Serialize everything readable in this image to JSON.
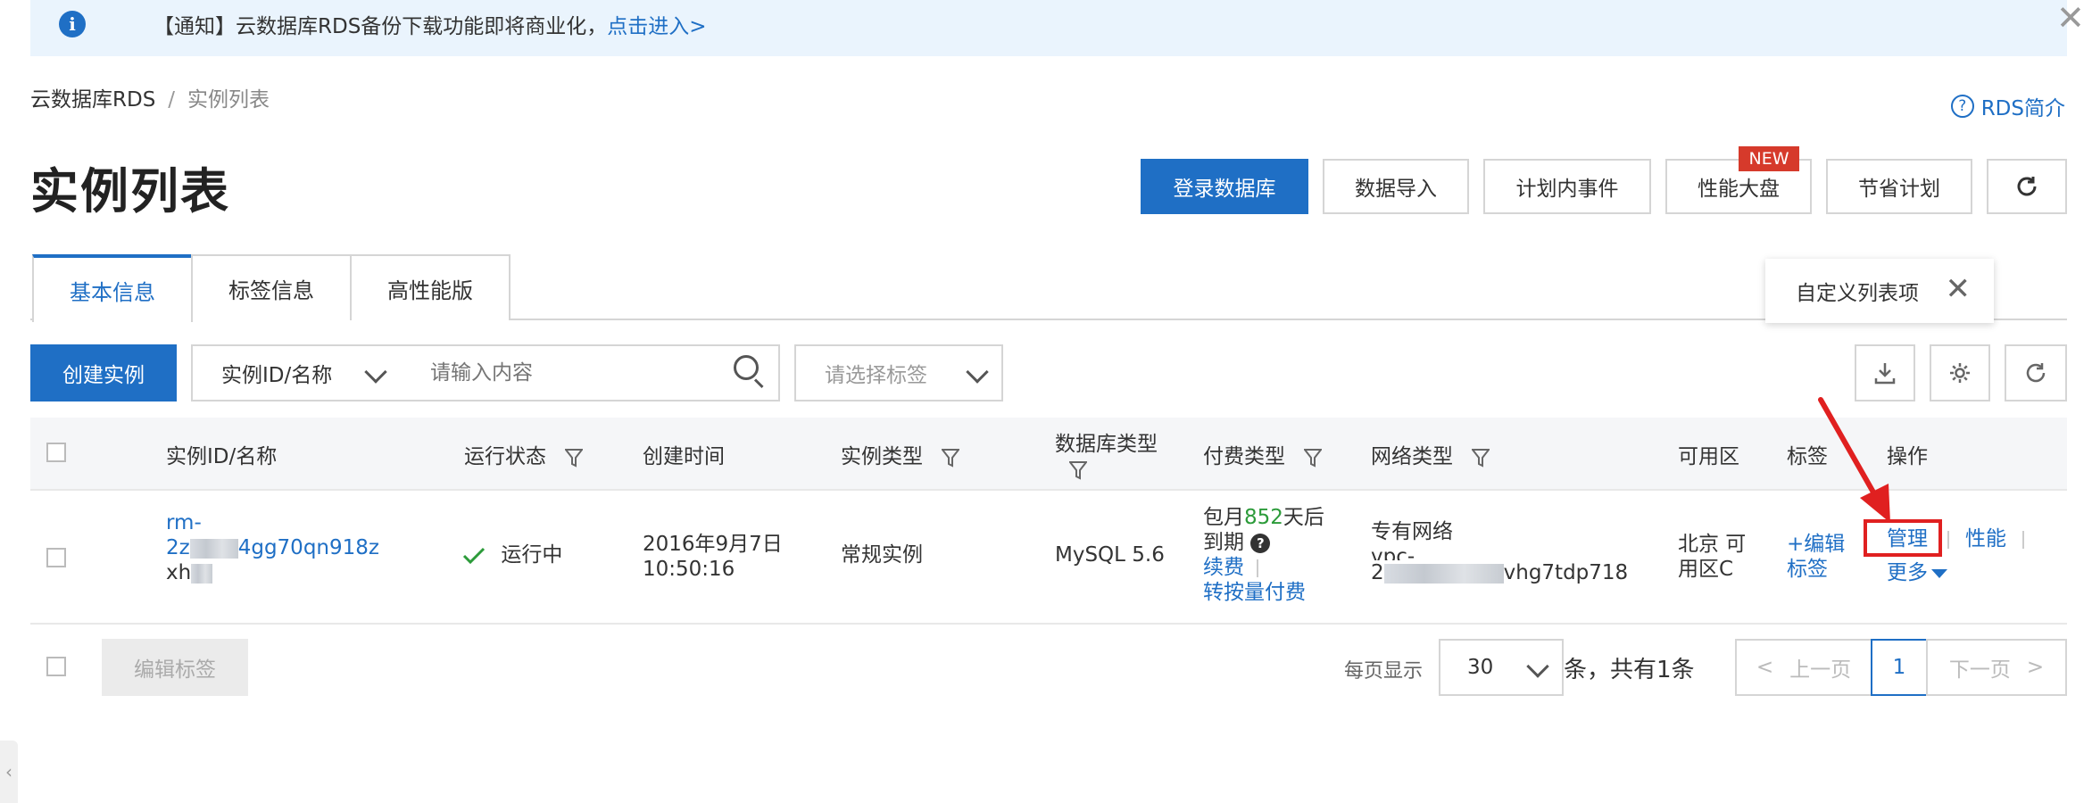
{
  "notice": {
    "icon": "info-icon",
    "text": "【通知】云数据库RDS备份下载功能即将商业化，",
    "link": "点击进入>"
  },
  "breadcrumb": {
    "root": "云数据库RDS",
    "separator": "/",
    "current": "实例列表"
  },
  "help_link": "RDS简介",
  "page_title": "实例列表",
  "top_buttons": {
    "login_db": "登录数据库",
    "data_import": "数据导入",
    "planned_events": "计划内事件",
    "perf_dashboard": "性能大盘",
    "new_badge": "NEW",
    "savings_plan": "节省计划"
  },
  "tabs": [
    "基本信息",
    "标签信息",
    "高性能版"
  ],
  "popover": {
    "text": "自定义列表项"
  },
  "toolbar": {
    "create_label": "创建实例",
    "filter_field": "实例ID/名称",
    "search_placeholder": "请输入内容",
    "tag_placeholder": "请选择标签"
  },
  "columns": {
    "id": "实例ID/名称",
    "status": "运行状态",
    "created": "创建时间",
    "instance_type": "实例类型",
    "db_type": "数据库类型",
    "billing": "付费类型",
    "network": "网络类型",
    "zone": "可用区",
    "tags": "标签",
    "actions": "操作"
  },
  "row": {
    "id_line1": "rm-",
    "id_line2_prefix": "2z",
    "id_line2_suffix": "4gg70qn918z",
    "name_prefix": "xh",
    "status": "运行中",
    "created_date": "2016年9月7日",
    "created_time": "10:50:16",
    "instance_type": "常规实例",
    "db_type": "MySQL 5.6",
    "billing_prefix": "包月",
    "billing_days": "852",
    "billing_suffix": "天后",
    "billing_line2": "到期",
    "renew": "续费",
    "to_payg": "转按量付费",
    "network": "专有网络",
    "vpc_prefix": "vpc-",
    "vpc_line2_prefix": "2",
    "vpc_line2_suffix": "vhg7tdp718",
    "zone_line1": "北京 可",
    "zone_line2": "用区C",
    "tag_line1": "+编辑",
    "tag_line2": "标签",
    "action_manage": "管理",
    "action_perf": "性能",
    "action_more": "更多"
  },
  "footer": {
    "edit_tags": "编辑标签",
    "per_page_label": "每页显示",
    "per_page_value": "30",
    "total": "条，共有1条",
    "prev": "上一页",
    "current_page": "1",
    "next": "下一页"
  },
  "colors": {
    "primary": "#1f6fc5",
    "highlight": "#e02020",
    "success": "#2c9b3a",
    "new_badge": "#d63a2b"
  }
}
